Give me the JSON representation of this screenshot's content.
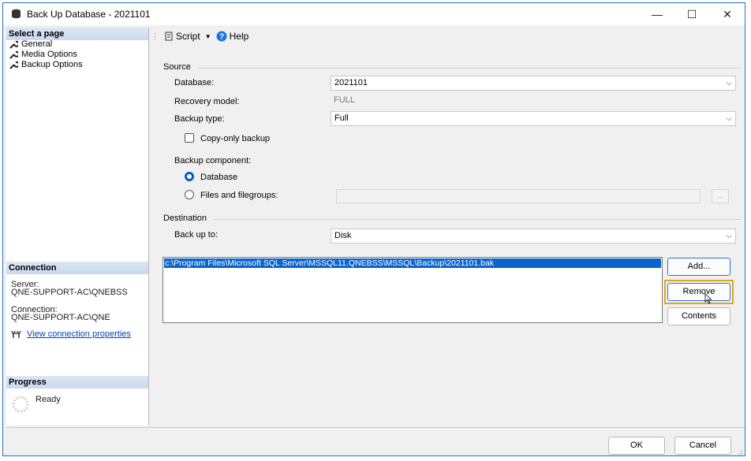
{
  "window": {
    "title": "Back Up Database - 2021101",
    "minimize": "—",
    "maximize": "☐",
    "close": "✕"
  },
  "left_panel": {
    "select_page_header": "Select a page",
    "pages": [
      {
        "label": "General"
      },
      {
        "label": "Media Options"
      },
      {
        "label": "Backup Options"
      }
    ],
    "connection_header": "Connection",
    "server_label": "Server:",
    "server_value": "QNE-SUPPORT-AC\\QNEBSS",
    "connection_label": "Connection:",
    "connection_value": "QNE-SUPPORT-AC\\QNE",
    "view_connection_link": "View connection properties",
    "progress_header": "Progress",
    "progress_status": "Ready"
  },
  "toolbar": {
    "script_label": "Script",
    "help_label": "Help"
  },
  "source": {
    "group_title": "Source",
    "database_label": "Database:",
    "database_value": "2021101",
    "recovery_label": "Recovery model:",
    "recovery_value": "FULL",
    "backup_type_label": "Backup type:",
    "backup_type_value": "Full",
    "copy_only_label": "Copy-only backup",
    "component_label": "Backup component:",
    "component_database": "Database",
    "component_files": "Files and filegroups:",
    "browse_label": "..."
  },
  "destination": {
    "group_title": "Destination",
    "back_up_to_label": "Back up to:",
    "back_up_to_value": "Disk",
    "paths": [
      "c:\\Program Files\\Microsoft SQL Server\\MSSQL11.QNEBSS\\MSSQL\\Backup\\2021101.bak"
    ],
    "add_button": "Add...",
    "remove_button": "Remove",
    "contents_button": "Contents"
  },
  "footer": {
    "ok_button": "OK",
    "cancel_button": "Cancel"
  },
  "colors": {
    "accent": "#0a64cc",
    "highlight": "#e2a421",
    "link": "#0645ad"
  }
}
